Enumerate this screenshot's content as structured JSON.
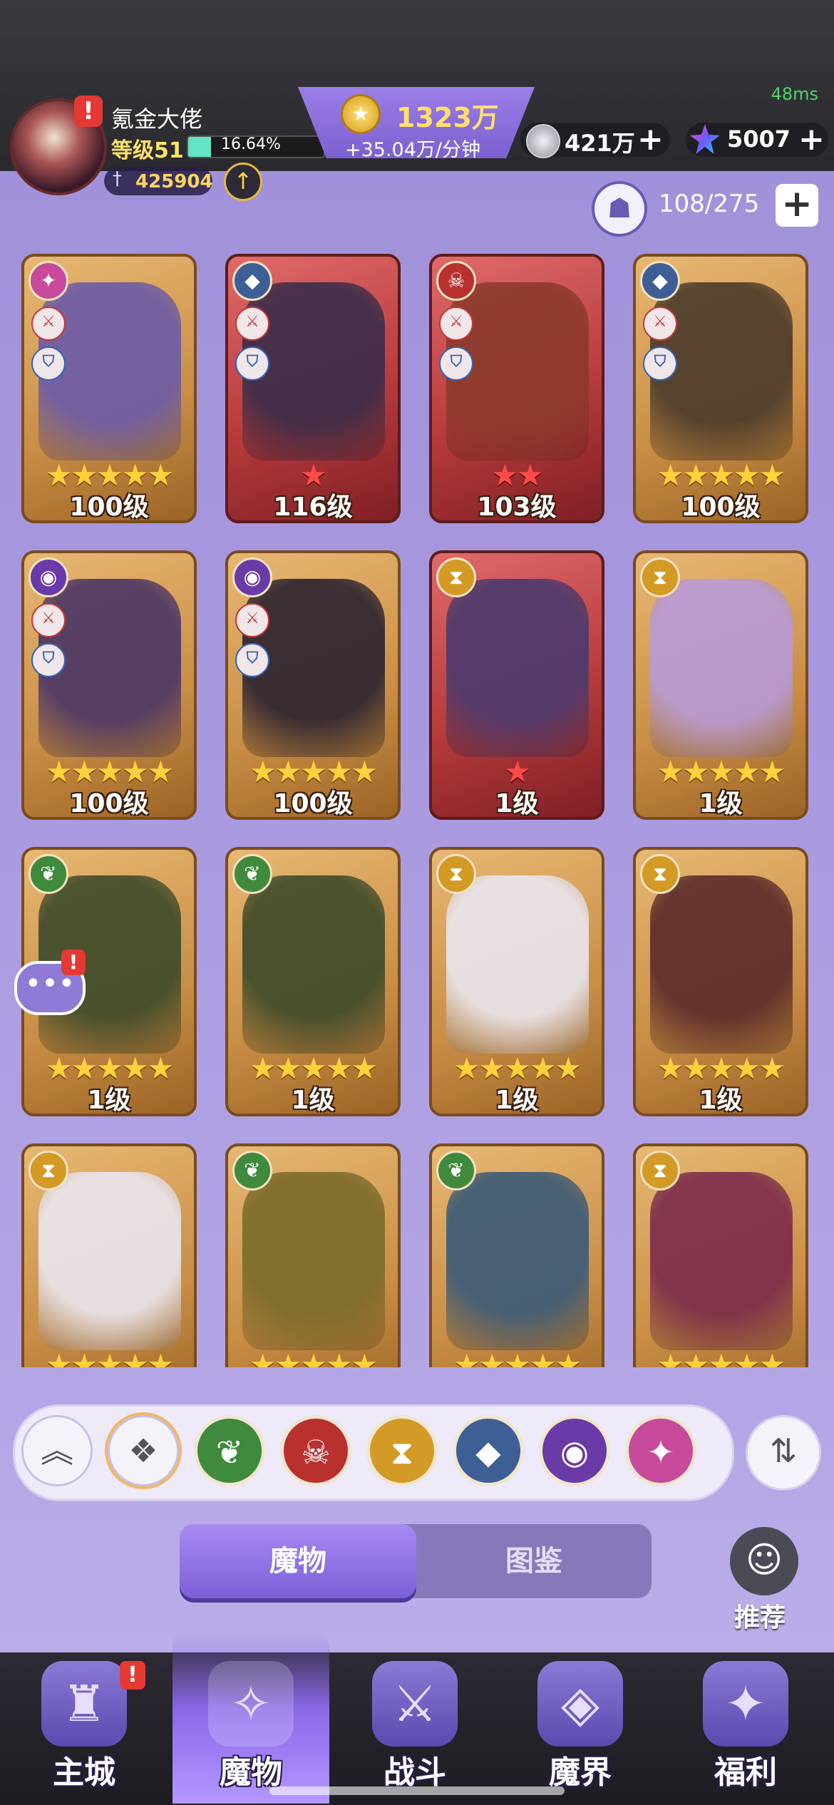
{
  "status": {
    "ping": "48ms"
  },
  "player": {
    "name": "氪金大佬",
    "level_label": "等级51",
    "xp_percent_text": "16.64%",
    "xp_fraction": 0.1664,
    "power": "425904",
    "icons": {
      "avatar": "avatar",
      "power": "sword-icon",
      "upgrade": "arrow-up-icon"
    }
  },
  "resources": {
    "gold": "1323万",
    "gold_rate": "+35.04万/分钟",
    "silver": "421万",
    "crystal": "5007"
  },
  "capacity": {
    "text": "108/275"
  },
  "monsters": [
    {
      "stars": 5,
      "star_color": "gold",
      "level": "100级",
      "faction_icon": "chaos-icon",
      "card_color": "gold",
      "badges": [
        "attack",
        "shield"
      ]
    },
    {
      "stars": 1,
      "star_color": "red",
      "level": "116级",
      "faction_icon": "dragon-icon",
      "card_color": "red",
      "badges": [
        "attack",
        "shield"
      ]
    },
    {
      "stars": 2,
      "star_color": "red",
      "level": "103级",
      "faction_icon": "demon-icon",
      "card_color": "red",
      "badges": [
        "attack",
        "shield"
      ]
    },
    {
      "stars": 5,
      "star_color": "gold",
      "level": "100级",
      "faction_icon": "dragon-icon",
      "card_color": "gold",
      "badges": [
        "attack",
        "shield"
      ]
    },
    {
      "stars": 5,
      "star_color": "gold",
      "level": "100级",
      "faction_icon": "eye-icon",
      "card_color": "gold",
      "badges": [
        "attack",
        "shield"
      ]
    },
    {
      "stars": 5,
      "star_color": "gold",
      "level": "100级",
      "faction_icon": "eye-icon",
      "card_color": "gold",
      "badges": [
        "attack",
        "shield"
      ]
    },
    {
      "stars": 1,
      "star_color": "red",
      "level": "1级",
      "faction_icon": "hourglass-icon",
      "card_color": "red",
      "badges": []
    },
    {
      "stars": 5,
      "star_color": "gold",
      "level": "1级",
      "faction_icon": "hourglass-icon",
      "card_color": "gold",
      "badges": []
    },
    {
      "stars": 5,
      "star_color": "gold",
      "level": "1级",
      "faction_icon": "leaf-icon",
      "card_color": "gold",
      "badges": []
    },
    {
      "stars": 5,
      "star_color": "gold",
      "level": "1级",
      "faction_icon": "leaf-icon",
      "card_color": "gold",
      "badges": []
    },
    {
      "stars": 5,
      "star_color": "gold",
      "level": "1级",
      "faction_icon": "hourglass-icon",
      "card_color": "gold",
      "badges": []
    },
    {
      "stars": 5,
      "star_color": "gold",
      "level": "1级",
      "faction_icon": "hourglass-icon",
      "card_color": "gold",
      "badges": []
    },
    {
      "stars": 5,
      "star_color": "gold",
      "level": "",
      "faction_icon": "hourglass-icon",
      "card_color": "gold",
      "badges": []
    },
    {
      "stars": 5,
      "star_color": "gold",
      "level": "",
      "faction_icon": "leaf-icon",
      "card_color": "gold",
      "badges": []
    },
    {
      "stars": 5,
      "star_color": "gold",
      "level": "",
      "faction_icon": "leaf-icon",
      "card_color": "gold",
      "badges": []
    },
    {
      "stars": 5,
      "star_color": "gold",
      "level": "",
      "faction_icon": "hourglass-icon",
      "card_color": "gold",
      "badges": []
    }
  ],
  "filters": [
    {
      "name": "collapse-icon",
      "color": "#f5f3fa"
    },
    {
      "name": "all-factions-icon",
      "color": "#f5f3fa"
    },
    {
      "name": "leaf-icon",
      "color": "#3f8a3c"
    },
    {
      "name": "demon-icon",
      "color": "#b8312f"
    },
    {
      "name": "hourglass-icon",
      "color": "#d49a26"
    },
    {
      "name": "dragon-icon",
      "color": "#3e5f96"
    },
    {
      "name": "eye-icon",
      "color": "#6a3aa8"
    },
    {
      "name": "chaos-icon",
      "color": "#c84a9a"
    }
  ],
  "sort": {
    "icon": "sort-icon"
  },
  "tabs": {
    "active": "魔物",
    "inactive": "图鉴"
  },
  "recommend": {
    "label": "推荐"
  },
  "nav": [
    {
      "label": "主城",
      "icon": "castle-icon",
      "alert": true
    },
    {
      "label": "魔物",
      "icon": "monster-icon",
      "alert": false,
      "active": true
    },
    {
      "label": "战斗",
      "icon": "battle-icon",
      "alert": false
    },
    {
      "label": "魔界",
      "icon": "realm-icon",
      "alert": false
    },
    {
      "label": "福利",
      "icon": "gift-icon",
      "alert": false
    }
  ],
  "colors": {
    "accent": "#7d5fd8",
    "gold_text": "#ffe06a",
    "alert": "#e53935"
  }
}
